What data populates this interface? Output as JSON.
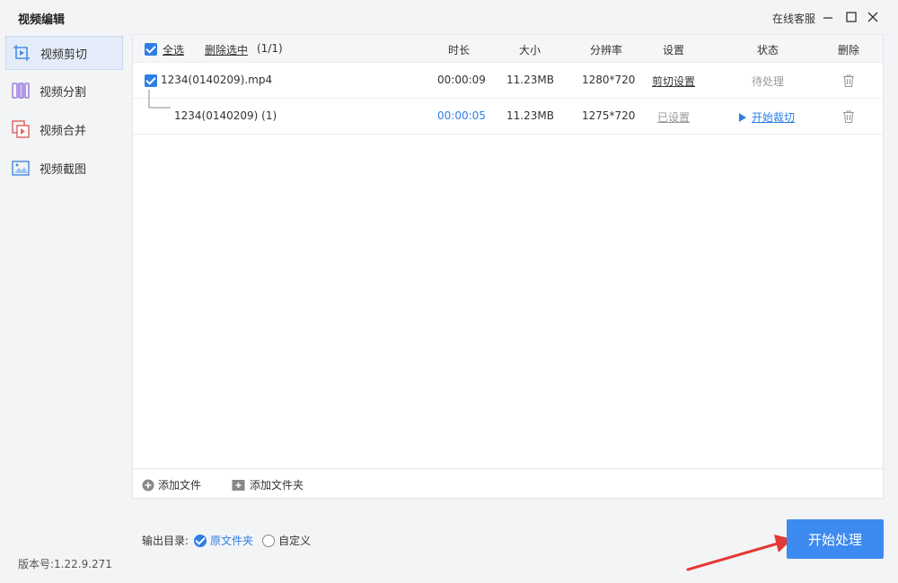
{
  "window": {
    "title": "视频编辑",
    "customer_service": "在线客服"
  },
  "sidebar": {
    "items": [
      {
        "label": "视频剪切",
        "icon": "crop-video-icon",
        "active": true
      },
      {
        "label": "视频分割",
        "icon": "split-video-icon",
        "active": false
      },
      {
        "label": "视频合并",
        "icon": "merge-video-icon",
        "active": false
      },
      {
        "label": "视频截图",
        "icon": "screenshot-icon",
        "active": false
      }
    ],
    "version": "版本号:1.22.9.271"
  },
  "table": {
    "select_all": "全选",
    "delete_selected": "删除选中",
    "count": "(1/1)",
    "columns": {
      "duration": "时长",
      "size": "大小",
      "resolution": "分辨率",
      "settings": "设置",
      "status": "状态",
      "delete": "删除"
    },
    "rows": [
      {
        "name": "1234(0140209).mp4",
        "duration": "00:00:09",
        "size": "11.23MB",
        "resolution": "1280*720",
        "settings": "剪切设置",
        "status": "待处理"
      },
      {
        "name": "1234(0140209) (1)",
        "duration": "00:00:05",
        "size": "11.23MB",
        "resolution": "1275*720",
        "settings": "已设置",
        "status": "开始裁切"
      }
    ]
  },
  "bottom": {
    "add_file": "添加文件",
    "add_folder": "添加文件夹"
  },
  "output": {
    "label": "输出目录:",
    "option_original": "原文件夹",
    "option_custom": "自定义"
  },
  "start_button": "开始处理",
  "colors": {
    "accent": "#3d8af0",
    "link_blue": "#2f7ee6",
    "arrow_red": "#e53935"
  }
}
